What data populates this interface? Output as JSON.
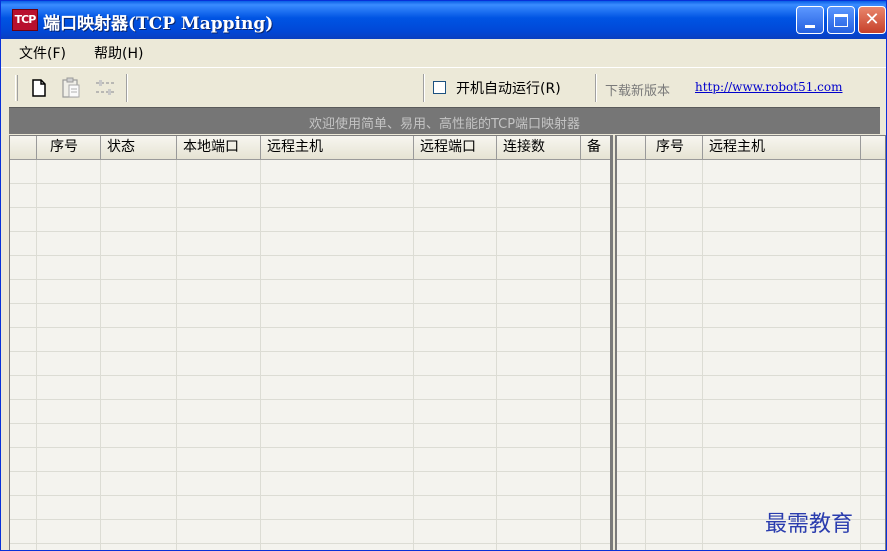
{
  "window": {
    "icon_text": "TCP",
    "title": "端口映射器(TCP Mapping)"
  },
  "menu": {
    "file": "文件(F)",
    "help": "帮助(H)"
  },
  "toolbar": {
    "new_icon": "new-document-icon",
    "paste_icon": "clipboard-icon",
    "settings_icon": "settings-sliders-icon",
    "autorun_checked": false,
    "autorun_label": "开机自动运行(R)",
    "download_label": "下载新版本",
    "download_link": "http://www.robot51.com"
  },
  "banner": {
    "text": "欢迎使用简单、易用、高性能的TCP端口映射器"
  },
  "left_list": {
    "columns": [
      "",
      "序号",
      "状态",
      "本地端口",
      "远程主机",
      "远程端口",
      "连接数",
      "备"
    ],
    "rows": []
  },
  "right_list": {
    "columns": [
      "",
      "序号",
      "远程主机",
      ""
    ],
    "rows": []
  },
  "watermark": "最需教育",
  "colors": {
    "titlebar": "#0054e3",
    "banner": "#767676",
    "link": "#0000cc",
    "watermark": "#2a3cae"
  }
}
